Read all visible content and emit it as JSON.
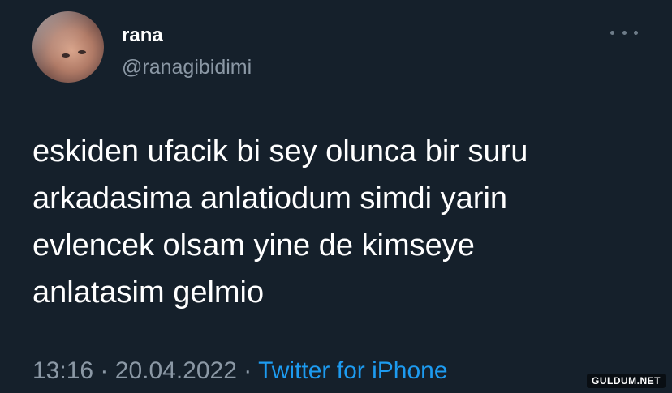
{
  "author": {
    "display_name": "rana",
    "handle": "@ranagibidimi",
    "avatar_icon": "profile-photo"
  },
  "menu": {
    "icon": "more-options-icon"
  },
  "tweet": {
    "lines": [
      "eskiden ufacik bi sey olunca bir suru",
      "arkadasima anlatiodum simdi yarin",
      "evlencek olsam yine de kimseye",
      "anlatasim gelmio"
    ]
  },
  "meta": {
    "time": "13:16",
    "separator": "·",
    "date": "20.04.2022",
    "source": "Twitter for iPhone"
  },
  "watermark": "GULDUM.NET",
  "colors": {
    "background": "#15202b",
    "text": "#ffffff",
    "secondary": "#8b98a5",
    "link": "#1d9bf0"
  }
}
